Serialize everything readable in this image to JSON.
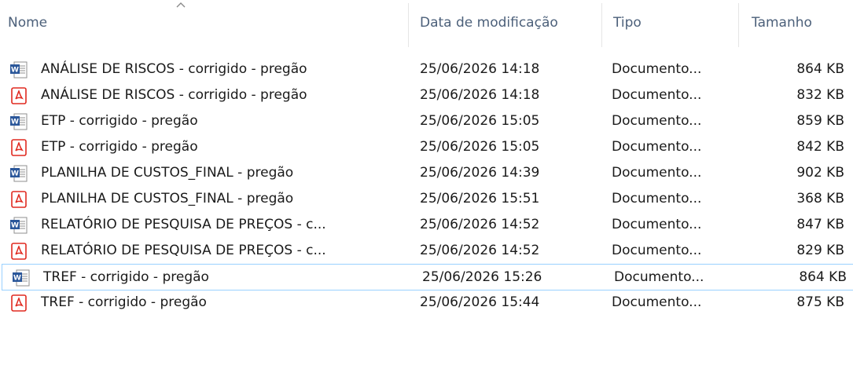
{
  "columns": {
    "name": "Nome",
    "date": "Data de modificação",
    "type": "Tipo",
    "size": "Tamanho"
  },
  "sort": {
    "column": "name",
    "direction": "ascending",
    "icon": "sort-up-arrow-icon"
  },
  "files": [
    {
      "name": "ANÁLISE DE RISCOS - corrigido - pregão",
      "date": "25/06/2026 14:18",
      "type": "Documento...",
      "size": "864 KB",
      "icon": "word-document-icon"
    },
    {
      "name": "ANÁLISE DE RISCOS - corrigido - pregão",
      "date": "25/06/2026 14:18",
      "type": "Documento...",
      "size": "832 KB",
      "icon": "pdf-document-icon"
    },
    {
      "name": "ETP - corrigido - pregão",
      "date": "25/06/2026 15:05",
      "type": "Documento...",
      "size": "859 KB",
      "icon": "word-document-icon"
    },
    {
      "name": "ETP - corrigido - pregão",
      "date": "25/06/2026 15:05",
      "type": "Documento...",
      "size": "842 KB",
      "icon": "pdf-document-icon"
    },
    {
      "name": "PLANILHA DE CUSTOS_FINAL - pregão",
      "date": "25/06/2026 14:39",
      "type": "Documento...",
      "size": "902 KB",
      "icon": "word-document-icon"
    },
    {
      "name": "PLANILHA DE CUSTOS_FINAL - pregão",
      "date": "25/06/2026 15:51",
      "type": "Documento...",
      "size": "368 KB",
      "icon": "pdf-document-icon"
    },
    {
      "name": "RELATÓRIO DE PESQUISA DE PREÇOS - c...",
      "date": "25/06/2026 14:52",
      "type": "Documento...",
      "size": "847 KB",
      "icon": "word-document-icon"
    },
    {
      "name": "RELATÓRIO DE PESQUISA DE PREÇOS - c...",
      "date": "25/06/2026 14:52",
      "type": "Documento...",
      "size": "829 KB",
      "icon": "pdf-document-icon"
    },
    {
      "name": "TREF - corrigido - pregão",
      "date": "25/06/2026 15:26",
      "type": "Documento...",
      "size": "864 KB",
      "icon": "word-document-icon",
      "selected": true
    },
    {
      "name": "TREF - corrigido - pregão",
      "date": "25/06/2026 15:44",
      "type": "Documento...",
      "size": "875 KB",
      "icon": "pdf-document-icon"
    }
  ],
  "colors": {
    "header_text": "#4c607a",
    "word_blue": "#2b579a",
    "pdf_red": "#e02a20",
    "selection_border": "#99d1ff"
  }
}
